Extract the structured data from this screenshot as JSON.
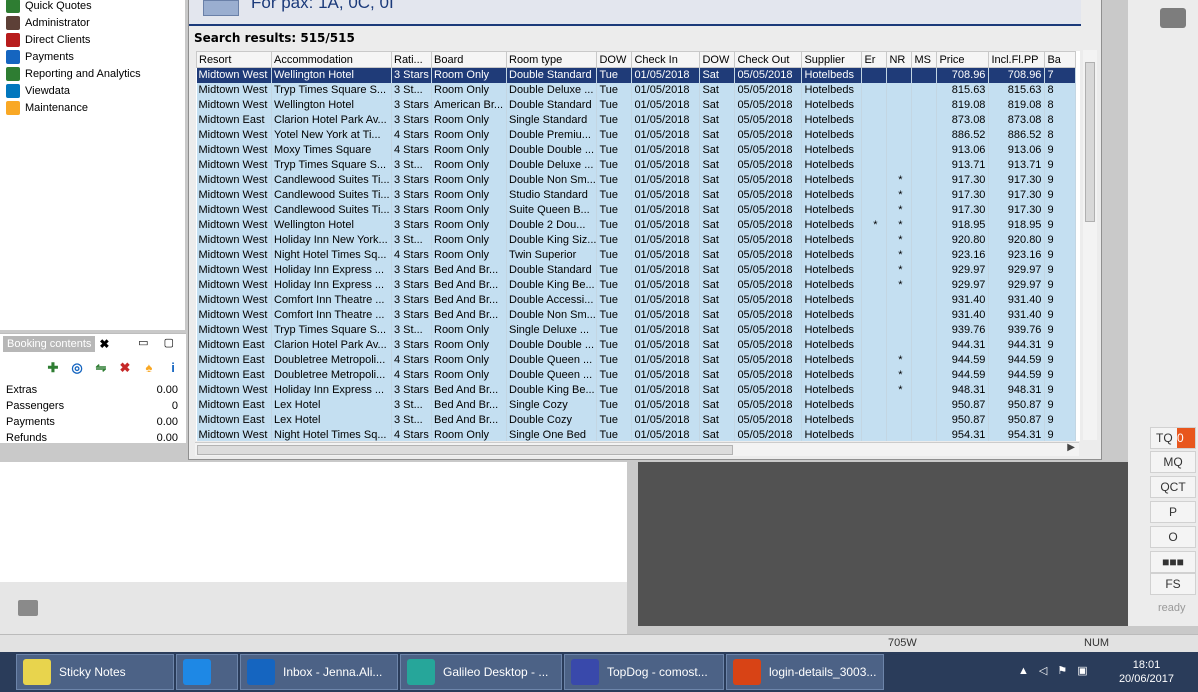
{
  "nav": {
    "items": [
      {
        "label": "Quick Quotes",
        "icon": "quick-quotes-icon",
        "color": "#2e7d32"
      },
      {
        "label": "Administrator",
        "icon": "administrator-icon",
        "color": "#5d4037"
      },
      {
        "label": "Direct Clients",
        "icon": "direct-clients-icon",
        "color": "#b71c1c"
      },
      {
        "label": "Payments",
        "icon": "payments-icon",
        "color": "#1565c0"
      },
      {
        "label": "Reporting and Analytics",
        "icon": "reporting-icon",
        "color": "#2e7d32"
      },
      {
        "label": "Viewdata",
        "icon": "viewdata-icon",
        "color": "#0277bd"
      },
      {
        "label": "Maintenance",
        "icon": "maintenance-icon",
        "color": "#f9a825"
      }
    ]
  },
  "booking": {
    "title": "Booking contents",
    "close": "✖",
    "window_controls": "▭ ▢",
    "tools": [
      "✚",
      "◎",
      "⇋",
      "✖",
      "♠",
      "i"
    ],
    "rows": [
      {
        "label": "Extras",
        "value": "0.00"
      },
      {
        "label": "Passengers",
        "value": "0"
      },
      {
        "label": "Payments",
        "value": "0.00"
      },
      {
        "label": "Refunds",
        "value": "0.00"
      }
    ]
  },
  "search": {
    "pax": "For pax: 1A, 0C, 0I",
    "results_label": "Search results: 515/515",
    "columns": [
      "Resort",
      "Accommodation",
      "Rati...",
      "Board",
      "Room type",
      "DOW",
      "Check In",
      "DOW",
      "Check Out",
      "Supplier",
      "Er",
      "NR",
      "MS",
      "Price",
      "Incl.Fl.PP",
      "Ba"
    ],
    "rows": [
      [
        "Midtown West",
        "Wellington Hotel",
        "3 Stars",
        "Room Only",
        "Double Standard",
        "Tue",
        "01/05/2018",
        "Sat",
        "05/05/2018",
        "Hotelbeds",
        "",
        "",
        "",
        "708.96",
        "708.96",
        "7"
      ],
      [
        "Midtown West",
        "Tryp Times Square S...",
        "3 St...",
        "Room Only",
        "Double Deluxe ...",
        "Tue",
        "01/05/2018",
        "Sat",
        "05/05/2018",
        "Hotelbeds",
        "",
        "",
        "",
        "815.63",
        "815.63",
        "8"
      ],
      [
        "Midtown West",
        "Wellington Hotel",
        "3 Stars",
        "American Br...",
        "Double Standard",
        "Tue",
        "01/05/2018",
        "Sat",
        "05/05/2018",
        "Hotelbeds",
        "",
        "",
        "",
        "819.08",
        "819.08",
        "8"
      ],
      [
        "Midtown East",
        "Clarion Hotel Park Av...",
        "3 Stars",
        "Room Only",
        "Single Standard",
        "Tue",
        "01/05/2018",
        "Sat",
        "05/05/2018",
        "Hotelbeds",
        "",
        "",
        "",
        "873.08",
        "873.08",
        "8"
      ],
      [
        "Midtown West",
        "Yotel New York at Ti...",
        "4 Stars",
        "Room Only",
        "Double Premiu...",
        "Tue",
        "01/05/2018",
        "Sat",
        "05/05/2018",
        "Hotelbeds",
        "",
        "",
        "",
        "886.52",
        "886.52",
        "8"
      ],
      [
        "Midtown West",
        "Moxy Times Square",
        "4 Stars",
        "Room Only",
        "Double Double ...",
        "Tue",
        "01/05/2018",
        "Sat",
        "05/05/2018",
        "Hotelbeds",
        "",
        "",
        "",
        "913.06",
        "913.06",
        "9"
      ],
      [
        "Midtown West",
        "Tryp Times Square S...",
        "3 St...",
        "Room Only",
        "Double Deluxe ...",
        "Tue",
        "01/05/2018",
        "Sat",
        "05/05/2018",
        "Hotelbeds",
        "",
        "",
        "",
        "913.71",
        "913.71",
        "9"
      ],
      [
        "Midtown West",
        "Candlewood Suites Ti...",
        "3 Stars",
        "Room Only",
        "Double Non Sm...",
        "Tue",
        "01/05/2018",
        "Sat",
        "05/05/2018",
        "Hotelbeds",
        "",
        "*",
        "",
        "917.30",
        "917.30",
        "9"
      ],
      [
        "Midtown West",
        "Candlewood Suites Ti...",
        "3 Stars",
        "Room Only",
        "Studio Standard",
        "Tue",
        "01/05/2018",
        "Sat",
        "05/05/2018",
        "Hotelbeds",
        "",
        "*",
        "",
        "917.30",
        "917.30",
        "9"
      ],
      [
        "Midtown West",
        "Candlewood Suites Ti...",
        "3 Stars",
        "Room Only",
        "Suite Queen B...",
        "Tue",
        "01/05/2018",
        "Sat",
        "05/05/2018",
        "Hotelbeds",
        "",
        "*",
        "",
        "917.30",
        "917.30",
        "9"
      ],
      [
        "Midtown West",
        "Wellington Hotel",
        "3 Stars",
        "Room Only",
        "Double 2 Dou...",
        "Tue",
        "01/05/2018",
        "Sat",
        "05/05/2018",
        "Hotelbeds",
        "*",
        "*",
        "",
        "918.95",
        "918.95",
        "9"
      ],
      [
        "Midtown West",
        "Holiday Inn New York...",
        "3 St...",
        "Room Only",
        "Double King Siz...",
        "Tue",
        "01/05/2018",
        "Sat",
        "05/05/2018",
        "Hotelbeds",
        "",
        "*",
        "",
        "920.80",
        "920.80",
        "9"
      ],
      [
        "Midtown West",
        "Night Hotel Times Sq...",
        "4 Stars",
        "Room Only",
        "Twin Superior",
        "Tue",
        "01/05/2018",
        "Sat",
        "05/05/2018",
        "Hotelbeds",
        "",
        "*",
        "",
        "923.16",
        "923.16",
        "9"
      ],
      [
        "Midtown West",
        "Holiday Inn Express ...",
        "3 Stars",
        "Bed And Br...",
        "Double Standard",
        "Tue",
        "01/05/2018",
        "Sat",
        "05/05/2018",
        "Hotelbeds",
        "",
        "*",
        "",
        "929.97",
        "929.97",
        "9"
      ],
      [
        "Midtown West",
        "Holiday Inn Express ...",
        "3 Stars",
        "Bed And Br...",
        "Double King Be...",
        "Tue",
        "01/05/2018",
        "Sat",
        "05/05/2018",
        "Hotelbeds",
        "",
        "*",
        "",
        "929.97",
        "929.97",
        "9"
      ],
      [
        "Midtown West",
        "Comfort Inn Theatre ...",
        "3 Stars",
        "Bed And Br...",
        "Double Accessi...",
        "Tue",
        "01/05/2018",
        "Sat",
        "05/05/2018",
        "Hotelbeds",
        "",
        "",
        "",
        "931.40",
        "931.40",
        "9"
      ],
      [
        "Midtown West",
        "Comfort Inn Theatre ...",
        "3 Stars",
        "Bed And Br...",
        "Double Non Sm...",
        "Tue",
        "01/05/2018",
        "Sat",
        "05/05/2018",
        "Hotelbeds",
        "",
        "",
        "",
        "931.40",
        "931.40",
        "9"
      ],
      [
        "Midtown West",
        "Tryp Times Square S...",
        "3 St...",
        "Room Only",
        "Single Deluxe ...",
        "Tue",
        "01/05/2018",
        "Sat",
        "05/05/2018",
        "Hotelbeds",
        "",
        "",
        "",
        "939.76",
        "939.76",
        "9"
      ],
      [
        "Midtown East",
        "Clarion Hotel Park Av...",
        "3 Stars",
        "Room Only",
        "Double Double ...",
        "Tue",
        "01/05/2018",
        "Sat",
        "05/05/2018",
        "Hotelbeds",
        "",
        "",
        "",
        "944.31",
        "944.31",
        "9"
      ],
      [
        "Midtown East",
        "Doubletree Metropoli...",
        "4 Stars",
        "Room Only",
        "Double Queen ...",
        "Tue",
        "01/05/2018",
        "Sat",
        "05/05/2018",
        "Hotelbeds",
        "",
        "*",
        "",
        "944.59",
        "944.59",
        "9"
      ],
      [
        "Midtown East",
        "Doubletree Metropoli...",
        "4 Stars",
        "Room Only",
        "Double Queen ...",
        "Tue",
        "01/05/2018",
        "Sat",
        "05/05/2018",
        "Hotelbeds",
        "",
        "*",
        "",
        "944.59",
        "944.59",
        "9"
      ],
      [
        "Midtown West",
        "Holiday Inn Express ...",
        "3 Stars",
        "Bed And Br...",
        "Double King Be...",
        "Tue",
        "01/05/2018",
        "Sat",
        "05/05/2018",
        "Hotelbeds",
        "",
        "*",
        "",
        "948.31",
        "948.31",
        "9"
      ],
      [
        "Midtown East",
        "Lex Hotel",
        "3 St...",
        "Bed And Br...",
        "Single Cozy",
        "Tue",
        "01/05/2018",
        "Sat",
        "05/05/2018",
        "Hotelbeds",
        "",
        "",
        "",
        "950.87",
        "950.87",
        "9"
      ],
      [
        "Midtown East",
        "Lex Hotel",
        "3 St...",
        "Bed And Br...",
        "Double Cozy",
        "Tue",
        "01/05/2018",
        "Sat",
        "05/05/2018",
        "Hotelbeds",
        "",
        "",
        "",
        "950.87",
        "950.87",
        "9"
      ],
      [
        "Midtown West",
        "Night Hotel Times Sq...",
        "4 Stars",
        "Room Only",
        "Single One Bed",
        "Tue",
        "01/05/2018",
        "Sat",
        "05/05/2018",
        "Hotelbeds",
        "",
        "",
        "",
        "954.31",
        "954.31",
        "9"
      ]
    ]
  },
  "side_buttons": [
    {
      "label": "TQ",
      "badge": "0"
    },
    {
      "label": "MQ"
    },
    {
      "label": "QCT"
    },
    {
      "label": "P"
    },
    {
      "label": "O"
    },
    {
      "label": "■■■"
    },
    {
      "label": "FS"
    }
  ],
  "side_status": "ready",
  "status_segments": [
    "705W",
    "NUM"
  ],
  "taskbar": {
    "items": [
      {
        "label": "Sticky Notes",
        "icon": "sticky-notes-icon",
        "color": "#e8d44d"
      },
      {
        "label": "",
        "icon": "galileo-g-icon",
        "color": "#1e88e5"
      },
      {
        "label": "Inbox - Jenna.Ali...",
        "icon": "outlook-icon",
        "color": "#1565c0"
      },
      {
        "label": "Galileo Desktop - ...",
        "icon": "galileo-desktop-icon",
        "color": "#26a69a"
      },
      {
        "label": "TopDog - comost...",
        "icon": "topdog-icon",
        "color": "#3949ab"
      },
      {
        "label": "login-details_3003...",
        "icon": "powerpoint-icon",
        "color": "#d84315"
      }
    ],
    "time": "18:01",
    "date": "20/06/2017"
  }
}
